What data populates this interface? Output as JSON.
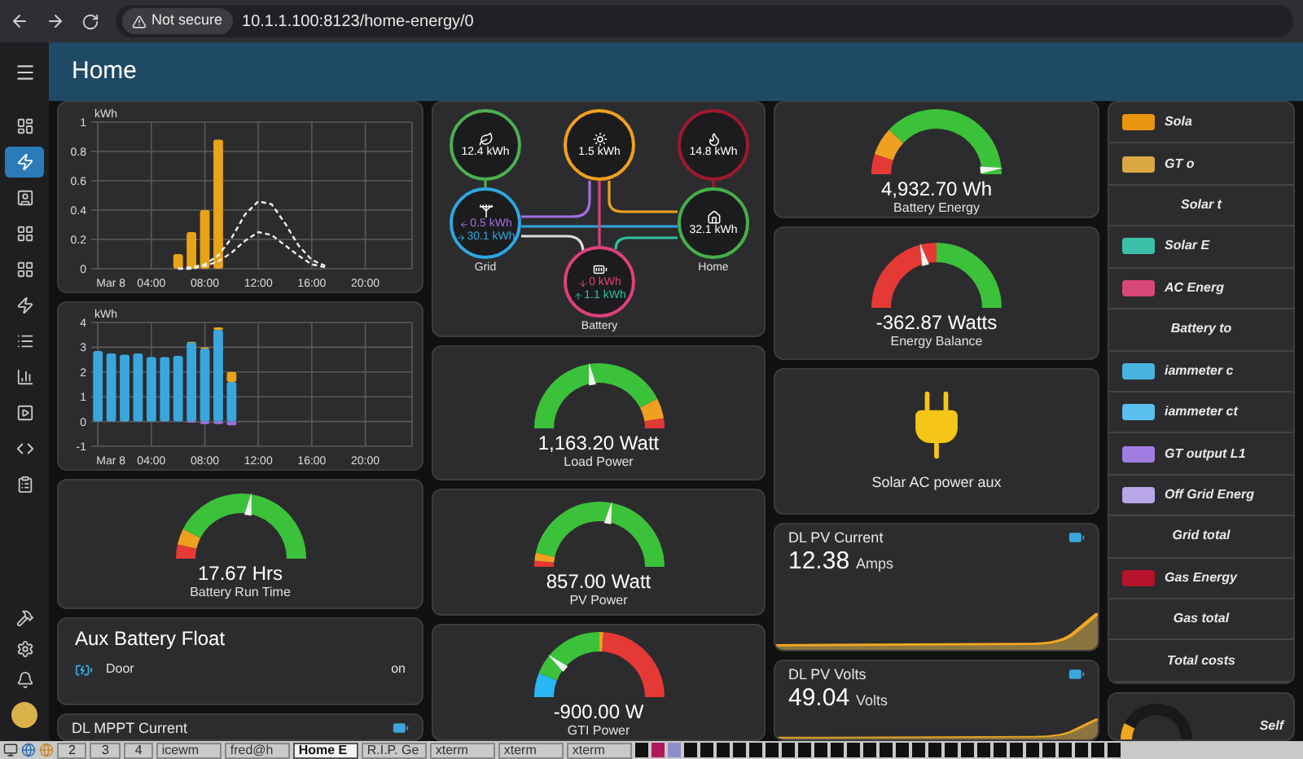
{
  "browser": {
    "security": "Not secure",
    "url": "10.1.1.100:8123/home-energy/0"
  },
  "header": {
    "title": "Home"
  },
  "sidebar": {
    "items": [
      {
        "selected": false
      },
      {
        "selected": true
      },
      {
        "selected": false
      },
      {
        "selected": false
      },
      {
        "selected": false
      },
      {
        "selected": false
      },
      {
        "selected": false
      },
      {
        "selected": false
      },
      {
        "selected": false
      },
      {
        "selected": false
      },
      {
        "selected": false
      }
    ]
  },
  "columns": [
    {
      "cards": [
        {
          "kind": "chart",
          "chart_data": {
            "type": "bar",
            "ylabel": "kWh",
            "x": [
              6,
              7,
              8,
              9,
              10,
              11,
              12,
              13,
              14,
              15,
              16,
              17
            ],
            "xlim": [
              -0.5,
              23.5
            ],
            "ylim": [
              0,
              1
            ],
            "yticks": [
              0,
              0.2,
              0.4,
              0.6,
              0.8,
              1
            ],
            "xticks": [
              {
                "value": 0,
                "label": "Mar 8"
              },
              {
                "value": 4,
                "label": "04:00"
              },
              {
                "value": 8,
                "label": "08:00"
              },
              {
                "value": 12,
                "label": "12:00"
              },
              {
                "value": 16,
                "label": "16:00"
              },
              {
                "value": 20,
                "label": "20:00"
              }
            ],
            "stacked": true,
            "grid": true,
            "series": [
              {
                "color": "#e8a317",
                "values": [
                  0.1,
                  0.25,
                  0.4,
                  0.88,
                  null,
                  null,
                  null,
                  null,
                  null,
                  null,
                  null,
                  null
                ]
              },
              {
                "type": "line",
                "line_style": "dashed",
                "color": "#eeeeee",
                "values": [
                  0,
                  0.01,
                  0.03,
                  0.09,
                  0.21,
                  0.37,
                  0.46,
                  0.44,
                  0.31,
                  0.16,
                  0.06,
                  0.02
                ]
              },
              {
                "type": "line",
                "line_style": "dashed",
                "color": "#eeeeee",
                "values": [
                  0,
                  0,
                  0.02,
                  0.05,
                  0.11,
                  0.19,
                  0.25,
                  0.23,
                  0.16,
                  0.09,
                  0.03,
                  0.01
                ]
              }
            ]
          }
        },
        {
          "kind": "chart",
          "chart_data": {
            "type": "bar",
            "ylabel": "kWh",
            "x": [
              0,
              1,
              2,
              3,
              4,
              5,
              6,
              7,
              8,
              9,
              10
            ],
            "xlim": [
              -0.5,
              23.5
            ],
            "ylim": [
              -1,
              4
            ],
            "yticks": [
              -1,
              0,
              1,
              2,
              3,
              4
            ],
            "xticks": [
              {
                "value": 0,
                "label": "Mar 8"
              },
              {
                "value": 4,
                "label": "04:00"
              },
              {
                "value": 8,
                "label": "08:00"
              },
              {
                "value": 12,
                "label": "12:00"
              },
              {
                "value": 16,
                "label": "16:00"
              },
              {
                "value": 20,
                "label": "20:00"
              }
            ],
            "stacked": true,
            "grid": true,
            "series": [
              {
                "color": "#3aa7dc",
                "values": [
                  2.85,
                  2.75,
                  2.7,
                  2.75,
                  2.6,
                  2.6,
                  2.65,
                  3.2,
                  2.95,
                  3.7,
                  1.6
                ]
              },
              {
                "color": "#e8a317",
                "values": [
                  0,
                  0,
                  0,
                  0,
                  0,
                  0,
                  0,
                  0.02,
                  0.05,
                  0.1,
                  0.4
                ]
              },
              {
                "color": "#a070e0",
                "values": [
                  0,
                  0,
                  0,
                  0,
                  0,
                  0,
                  0,
                  -0.05,
                  -0.1,
                  -0.1,
                  -0.15
                ]
              }
            ]
          }
        },
        {
          "kind": "gauge",
          "gauge": {
            "kind": "run_time",
            "level": 0.55
          },
          "value": "17.67 Hrs",
          "label": "Battery Run Time"
        },
        {
          "kind": "entities",
          "title": "Aux Battery Float",
          "rows": [
            {
              "name": "Door",
              "state": "on"
            }
          ]
        },
        {
          "kind": "sensor",
          "title": "DL MPPT Current"
        }
      ]
    },
    {
      "cards": [
        {
          "kind": "flow",
          "nodes": [
            {
              "color": "#4caf50",
              "lines": [
                {
                  "text": "12.4 kWh",
                  "color": "#ffffff"
                }
              ]
            },
            {
              "color": "#f0a020",
              "lines": [
                {
                  "text": "1.5 kWh",
                  "color": "#ffffff"
                }
              ]
            },
            {
              "color": "#a01830",
              "lines": [
                {
                  "text": "14.8 kWh",
                  "color": "#ffffff"
                }
              ]
            },
            {
              "color": "#2fa6e0",
              "label": "Grid",
              "lines": [
                {
                  "text": "0.5 kWh",
                  "kind": "left",
                  "color": "#a070e0"
                },
                {
                  "text": "30.1 kWh",
                  "kind": "right",
                  "color": "#2fa6e0"
                }
              ]
            },
            {
              "color": "#46b04a",
              "label": "Home",
              "lines": [
                {
                  "text": "32.1 kWh",
                  "color": "#ffffff"
                }
              ]
            },
            {
              "color": "#e0407a",
              "label": "Battery",
              "lines": [
                {
                  "text": "0 kWh",
                  "kind": "down",
                  "color": "#e0407a"
                },
                {
                  "text": "1.1 kWh",
                  "kind": "up",
                  "color": "#2fbfa0"
                }
              ]
            }
          ]
        },
        {
          "kind": "gauge",
          "gauge": {
            "kind": "load",
            "level": 0.45
          },
          "value": "1,163.20 Watt",
          "label": "Load Power"
        },
        {
          "kind": "gauge",
          "gauge": {
            "kind": "pv",
            "level": 0.56
          },
          "value": "857.00 Watt",
          "label": "PV Power"
        },
        {
          "kind": "gauge",
          "gauge": {
            "kind": "gti",
            "level": 0.22
          },
          "value": "-900.00 W",
          "label": "GTI Power"
        }
      ]
    },
    {
      "cards": [
        {
          "kind": "gauge",
          "gauge": {
            "kind": "battery_energy",
            "level": 0.97
          },
          "value": "4,932.70 Wh",
          "label": "Battery Energy"
        },
        {
          "kind": "gauge",
          "gauge": {
            "kind": "balance",
            "level": 0.42
          },
          "value": "-362.87 Watts",
          "label": "Energy Balance"
        },
        {
          "kind": "button",
          "name": "Solar AC power aux",
          "on": true
        },
        {
          "kind": "sensor",
          "title": "DL PV Current",
          "value": "12.38",
          "unit": "Amps"
        },
        {
          "kind": "sensor",
          "title": "DL PV Volts",
          "value": "49.04",
          "unit": "Volts"
        }
      ]
    },
    {
      "cards": [
        {
          "kind": "list",
          "rows": [
            {
              "kind": "source",
              "label": "Sola",
              "color": "#e8960f"
            },
            {
              "kind": "source",
              "label": "GT o",
              "color": "#d9a843"
            },
            {
              "kind": "total",
              "label": "Solar t"
            },
            {
              "kind": "source",
              "label": "Solar E",
              "color": "#3cbfa8"
            },
            {
              "kind": "source",
              "label": "AC Energ",
              "color": "#d6477a"
            },
            {
              "kind": "total",
              "label": "Battery to"
            },
            {
              "kind": "source",
              "label": "iammeter c",
              "color": "#47b4e0"
            },
            {
              "kind": "source",
              "label": "iammeter ct",
              "color": "#5bc0ee"
            },
            {
              "kind": "source",
              "label": "GT output L1",
              "color": "#a07de0"
            },
            {
              "kind": "source",
              "label": "Off Grid Energ",
              "color": "#b8a6e8"
            },
            {
              "kind": "total",
              "label": "Grid total"
            },
            {
              "kind": "source",
              "label": "Gas Energy",
              "color": "#b5132b"
            },
            {
              "kind": "total",
              "label": "Gas total"
            },
            {
              "kind": "total",
              "label": "Total costs"
            }
          ]
        },
        {
          "kind": "arc",
          "title": "Self"
        }
      ]
    }
  ],
  "taskbar": {
    "workspaces": [
      {
        "label": "2"
      },
      {
        "label": "3"
      },
      {
        "label": "4"
      }
    ],
    "tasks": [
      {
        "label": "icewm",
        "selected": false
      },
      {
        "label": "fred@h",
        "selected": false
      },
      {
        "label": "Home E",
        "selected": true
      },
      {
        "label": "R.I.P. Ge",
        "selected": false
      },
      {
        "label": "xterm",
        "selected": false
      },
      {
        "label": "xterm",
        "selected": false
      },
      {
        "label": "xterm",
        "selected": false
      }
    ]
  }
}
